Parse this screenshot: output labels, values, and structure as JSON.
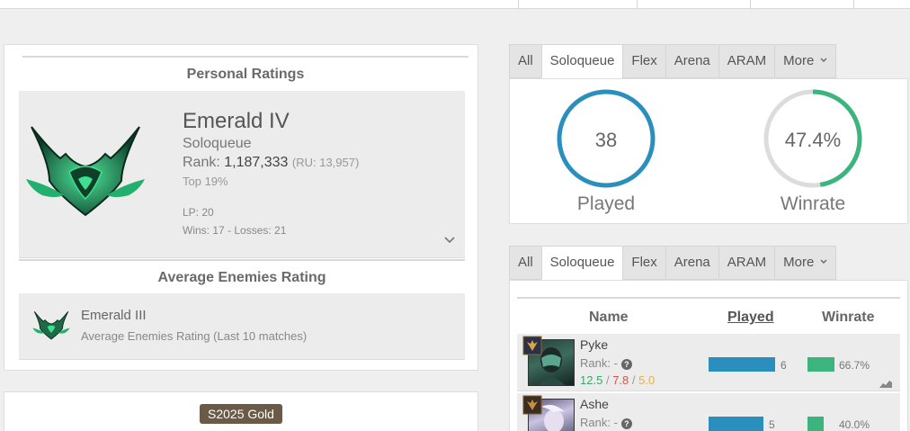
{
  "personal": {
    "header": "Personal Ratings",
    "rank": "Emerald IV",
    "queue": "Soloqueue",
    "rank_prefix": "Rank:",
    "rank_number": "1,187,333",
    "rank_ru": "(RU: 13,957)",
    "top": "Top 19%",
    "lp": "LP: 20",
    "wins_losses": "Wins: 17 - Losses: 21"
  },
  "enemies": {
    "header": "Average Enemies Rating",
    "rank": "Emerald III",
    "subtitle": "Average Enemies Rating (Last 10 matches)"
  },
  "season": {
    "badge": "S2025 Gold"
  },
  "tabs": [
    "All",
    "Soloqueue",
    "Flex",
    "Arena",
    "ARAM",
    "More"
  ],
  "stats": {
    "played_value": "38",
    "played_label": "Played",
    "winrate_value": "47.4%",
    "winrate_label": "Winrate",
    "winrate_fraction": 0.474
  },
  "champions": {
    "columns": {
      "name": "Name",
      "played": "Played",
      "winrate": "Winrate"
    },
    "rows": [
      {
        "name": "Pyke",
        "rank": "Rank: -",
        "kills": "12.5",
        "deaths": "7.8",
        "assists": "5.0",
        "sep": "/",
        "played": "6",
        "winrate": "66.7%",
        "played_fraction": 1.0,
        "winrate_fraction": 0.667
      },
      {
        "name": "Ashe",
        "rank": "Rank: -",
        "played": "5",
        "winrate": "40.0%",
        "played_fraction": 0.83,
        "winrate_fraction": 0.4
      }
    ]
  },
  "colors": {
    "accent_blue": "#2b8fbe",
    "accent_green": "#3bb47e",
    "emerald": "#2fb57c",
    "season_badge": "#6b5a45"
  }
}
